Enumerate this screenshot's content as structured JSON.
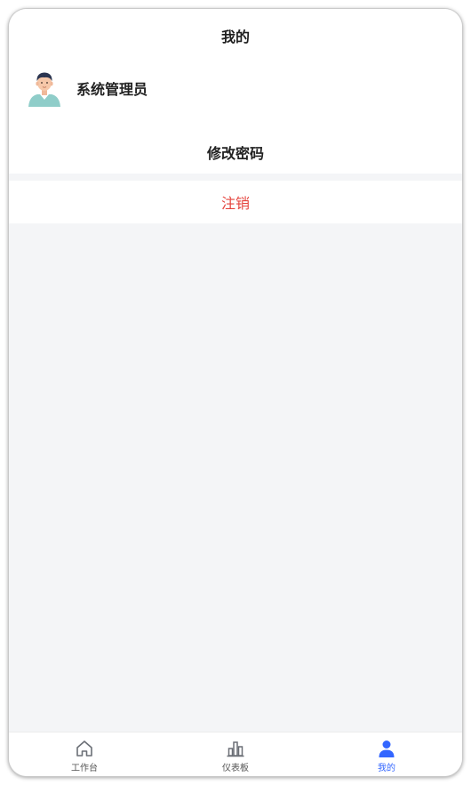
{
  "header": {
    "title": "我的"
  },
  "profile": {
    "name": "系统管理员",
    "avatar": "avatar-illustration"
  },
  "menu": {
    "change_password": "修改密码",
    "logout": "注销"
  },
  "tabbar": {
    "items": [
      {
        "label": "工作台",
        "icon": "home-icon",
        "active": false
      },
      {
        "label": "仪表板",
        "icon": "bar-chart-icon",
        "active": false
      },
      {
        "label": "我的",
        "icon": "user-icon",
        "active": true
      }
    ]
  },
  "colors": {
    "accent": "#3366ff",
    "danger": "#e5443d",
    "background": "#f4f5f7"
  }
}
